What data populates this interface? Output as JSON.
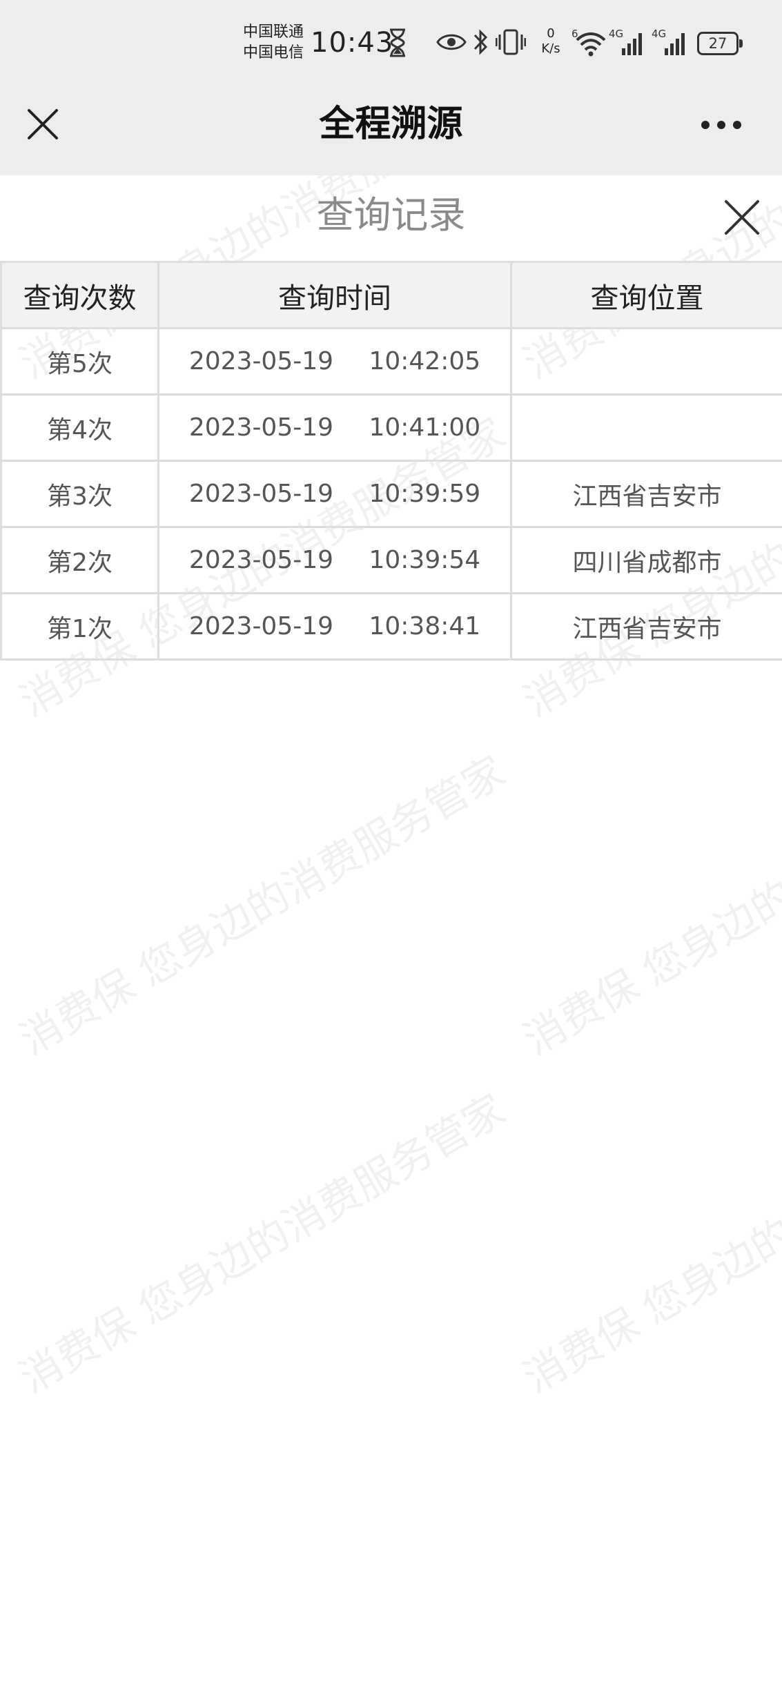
{
  "status_bar": {
    "carrier_line1": "中国联通",
    "carrier_line2": "中国电信",
    "time": "10:43",
    "net_speed_value": "0",
    "net_speed_unit": "K/s",
    "signal_label_1": "4G",
    "signal_label_2": "4G",
    "wifi_label": "6",
    "battery_level": "27",
    "icons": [
      "hourglass-icon",
      "eye-icon",
      "bluetooth-icon",
      "vibrate-icon",
      "wifi-icon",
      "signal-icon",
      "signal-icon",
      "battery-icon"
    ]
  },
  "nav": {
    "title": "全程溯源",
    "close_icon": "close-icon",
    "more_icon": "more-icon"
  },
  "modal": {
    "title": "查询记录",
    "close_icon": "close-icon"
  },
  "table": {
    "headers": [
      "查询次数",
      "查询时间",
      "查询位置"
    ],
    "rows": [
      {
        "count": "第5次",
        "time": "2023-05-19 10:42:05",
        "location": ""
      },
      {
        "count": "第4次",
        "time": "2023-05-19 10:41:00",
        "location": ""
      },
      {
        "count": "第3次",
        "time": "2023-05-19 10:39:59",
        "location": "江西省吉安市"
      },
      {
        "count": "第2次",
        "time": "2023-05-19 10:39:54",
        "location": "四川省成都市"
      },
      {
        "count": "第1次",
        "time": "2023-05-19 10:38:41",
        "location": "江西省吉安市"
      }
    ]
  },
  "watermark": {
    "text": "消费保 您身边的消费服务管家"
  },
  "colors": {
    "bar_background": "#ededed",
    "header_background": "#f2f2f2",
    "border": "#dddddd",
    "modal_title": "#8a8a8a"
  }
}
